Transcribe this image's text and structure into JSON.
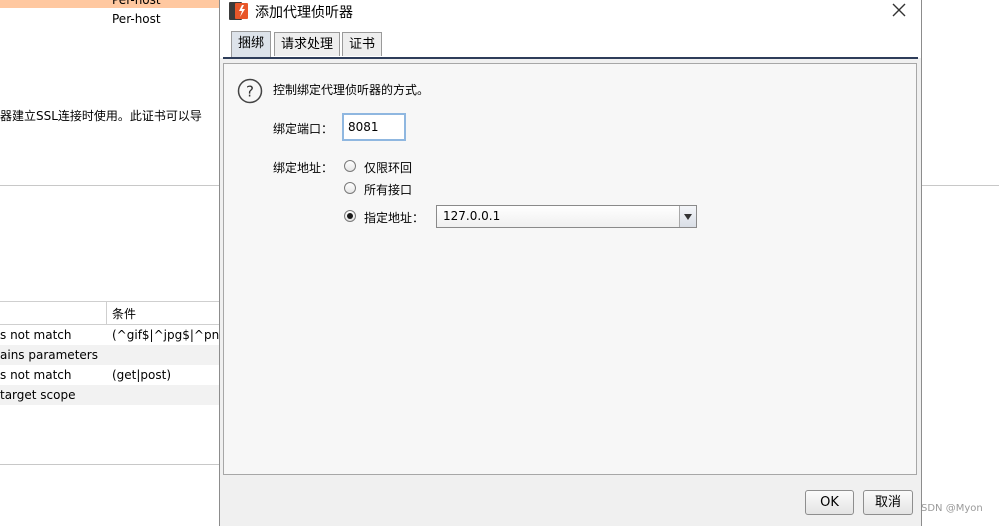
{
  "background": {
    "rows_top": [
      {
        "value": "Per-host"
      },
      {
        "value": "Per-host"
      }
    ],
    "description_text": "器建立SSL连接时使用。此证书可以导",
    "table": {
      "header_condition": "条件",
      "rows": [
        {
          "col1": "s not match",
          "col2": "(^gif$|^jpg$|^png$|^c"
        },
        {
          "col1": "ains parameters",
          "col2": ""
        },
        {
          "col1": "s not match",
          "col2": "(get|post)"
        },
        {
          "col1": "target scope",
          "col2": ""
        }
      ]
    }
  },
  "dialog": {
    "title": "添加代理侦听器",
    "tabs": [
      {
        "label": "捆绑",
        "active": true
      },
      {
        "label": "请求处理",
        "active": false
      },
      {
        "label": "证书",
        "active": false
      }
    ],
    "help_text": "控制绑定代理侦听器的方式。",
    "port_label": "绑定端口：",
    "port_value": "8081",
    "address_label": "绑定地址：",
    "address_options": [
      {
        "label": "仅限环回",
        "selected": false
      },
      {
        "label": "所有接口",
        "selected": false
      },
      {
        "label": "指定地址：",
        "selected": true
      }
    ],
    "address_select_value": "127.0.0.1",
    "ok_label": "OK",
    "cancel_label": "取消",
    "accent_color": "#e8572a"
  },
  "watermark": "CSDN @Myon⁠"
}
